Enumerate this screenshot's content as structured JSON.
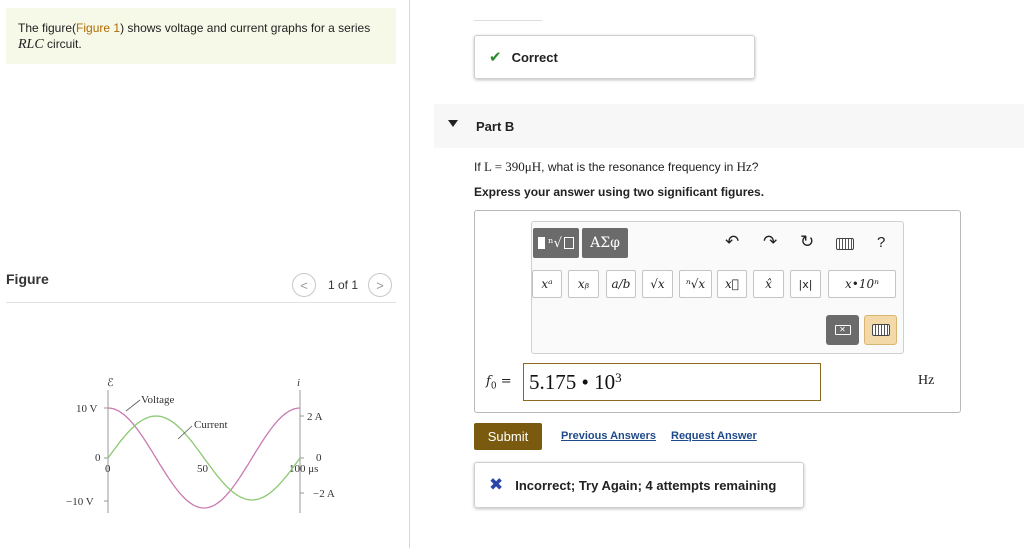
{
  "intro": {
    "text_before": "The figure(",
    "figure_link": "Figure 1",
    "text_after": ") shows voltage and current graphs for a series ",
    "circuit": "RLC",
    "text_end": " circuit."
  },
  "figure_panel": {
    "title": "Figure",
    "counter": "1 of 1",
    "prev_symbol": "<",
    "next_symbol": ">"
  },
  "graph": {
    "left_axis_symbol": "ℰ",
    "right_axis_symbol": "i",
    "y_labels_left": [
      "10 V",
      "0",
      "−10 V"
    ],
    "y_labels_right": [
      "2 A",
      "0",
      "−2 A"
    ],
    "x_tick_labels": [
      "0",
      "50",
      "100 μs"
    ],
    "series_labels": [
      "Voltage",
      "Current"
    ],
    "colors": {
      "voltage": "#c97bb0",
      "current": "#8bc870"
    },
    "series": [
      {
        "name": "Voltage",
        "amplitude": 10,
        "unit": "V",
        "peaks_at_us": [
          0,
          100
        ]
      },
      {
        "name": "Current",
        "amplitude": 2,
        "unit": "A",
        "peaks_at_us": [
          25
        ]
      }
    ]
  },
  "prev_part": {
    "status": "Correct"
  },
  "part_b": {
    "title": "Part B",
    "question_prefix": "If ",
    "question_math": "L = 390μH",
    "question_mid": ", what is the resonance frequency in ",
    "question_unit": "Hz",
    "question_end": "?",
    "instruction": "Express your answer using two significant figures."
  },
  "toolbar": {
    "template_root": "ⁿ√",
    "greek_label": "ΑΣφ",
    "help_label": "?",
    "keys": [
      "xᵃ",
      "xᵦ",
      "a/b",
      "√x",
      "ⁿ√x",
      "x⃗",
      "x̂",
      "|x|",
      "x•10ⁿ"
    ]
  },
  "answer": {
    "variable": "f",
    "variable_sub": "0",
    "equals": "=",
    "mantissa": "5.175 • 10",
    "exponent": "3",
    "unit": "Hz"
  },
  "actions": {
    "submit": "Submit",
    "previous_answers": "Previous Answers",
    "request_answer": "Request Answer"
  },
  "feedback": {
    "message": "Incorrect; Try Again; 4 attempts remaining"
  },
  "accent_colors": {
    "submit": "#7a5a0e",
    "link": "#1f4a8a",
    "correct": "#2c8a2c",
    "incorrect": "#2a46a8"
  }
}
